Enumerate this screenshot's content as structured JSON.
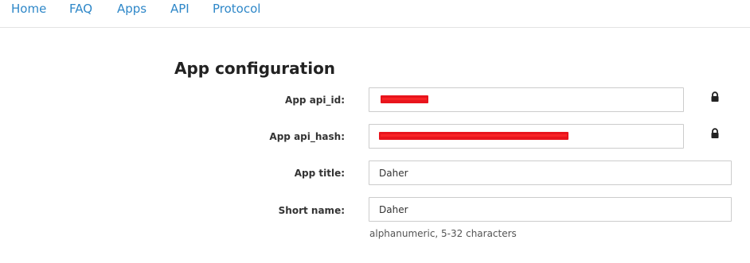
{
  "nav": {
    "items": [
      {
        "label": "Home"
      },
      {
        "label": "FAQ"
      },
      {
        "label": "Apps"
      },
      {
        "label": "API"
      },
      {
        "label": "Protocol"
      }
    ]
  },
  "page": {
    "title": "App configuration"
  },
  "form": {
    "api_id": {
      "label": "App api_id:",
      "value": "",
      "locked": true
    },
    "api_hash": {
      "label": "App api_hash:",
      "value": "",
      "locked": true
    },
    "app_title": {
      "label": "App title:",
      "value": "Daher"
    },
    "short_name": {
      "label": "Short name:",
      "value": "Daher",
      "hint": "alphanumeric, 5-32 characters"
    }
  },
  "icons": {
    "lock": "lock-icon"
  },
  "colors": {
    "link": "#2e87c8",
    "redaction": "#e8141c"
  }
}
